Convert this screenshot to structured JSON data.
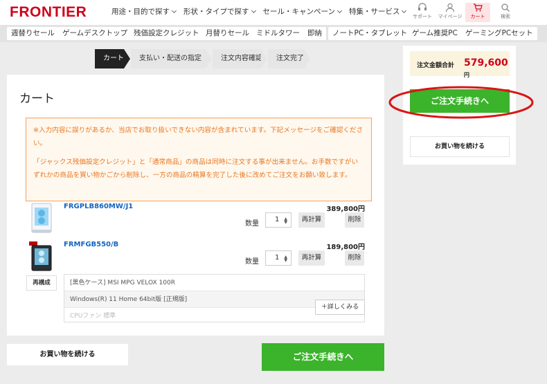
{
  "header": {
    "logo": "FRONTIER",
    "menu": [
      {
        "label": "用途・目的で探す"
      },
      {
        "label": "形状・タイプで探す"
      },
      {
        "label": "セール・キャンペーン"
      },
      {
        "label": "特集・サービス"
      }
    ],
    "icons": [
      {
        "icon": "support-icon",
        "label": "サポート"
      },
      {
        "icon": "user-icon",
        "label": "マイページ"
      },
      {
        "icon": "cart-icon",
        "label": "カート"
      },
      {
        "icon": "search-icon",
        "label": "検索"
      }
    ]
  },
  "categories": [
    "週替りセール",
    "ゲームデスクトップ",
    "残価設定クレジット",
    "月替りセール",
    "ミドルタワー",
    "即納",
    "ノートPC・タブレット",
    "ゲーム推奨PC",
    "ゲーミングPCセット"
  ],
  "steps": [
    "カート",
    "支払い・配送の指定",
    "注文内容確認",
    "注文完了"
  ],
  "cart": {
    "title": "カート",
    "notice": {
      "line1": "※入力内容に誤りがあるか、当店でお取り扱いできない内容が含まれています。下記メッセージをご確認ください。",
      "line2": "「ジャックス残価設定クレジット」と「通常商品」の商品は同時に注文する事が出来ません。お手数ですがいずれかの商品を買い物かごから削除し、一方の商品の精算を完了した後に改めてご注文をお願い致します。"
    },
    "items": [
      {
        "name": "FRGPLB860MW/J1",
        "qty_label": "数量",
        "qty": "1",
        "recalc": "再計算",
        "delete": "削除",
        "price": "389,800円"
      },
      {
        "name": "FRMFGB550/B",
        "qty_label": "数量",
        "qty": "1",
        "recalc": "再計算",
        "delete": "削除",
        "price": "189,800円"
      }
    ],
    "reconfigure": "再構成",
    "specs": [
      "[黒色ケース] MSI MPG VELOX 100R",
      "Windows(R) 11 Home 64bit版 [正規版]",
      "CPUファン 標準"
    ],
    "more": "＋詳しくみる",
    "continue_shopping": "お買い物を続ける",
    "checkout": "ご注文手続きへ"
  },
  "sidebar": {
    "total_label": "注文金額合計",
    "total_value": "579,600",
    "yen": "円",
    "checkout": "ご注文手続きへ",
    "continue_shopping": "お買い物を続ける"
  },
  "colors": {
    "brand": "#d0021b",
    "checkout_green": "#3bb32b",
    "notice_orange": "#e87722",
    "link_blue": "#1565c0",
    "highlight_ellipse": "#d81515"
  }
}
